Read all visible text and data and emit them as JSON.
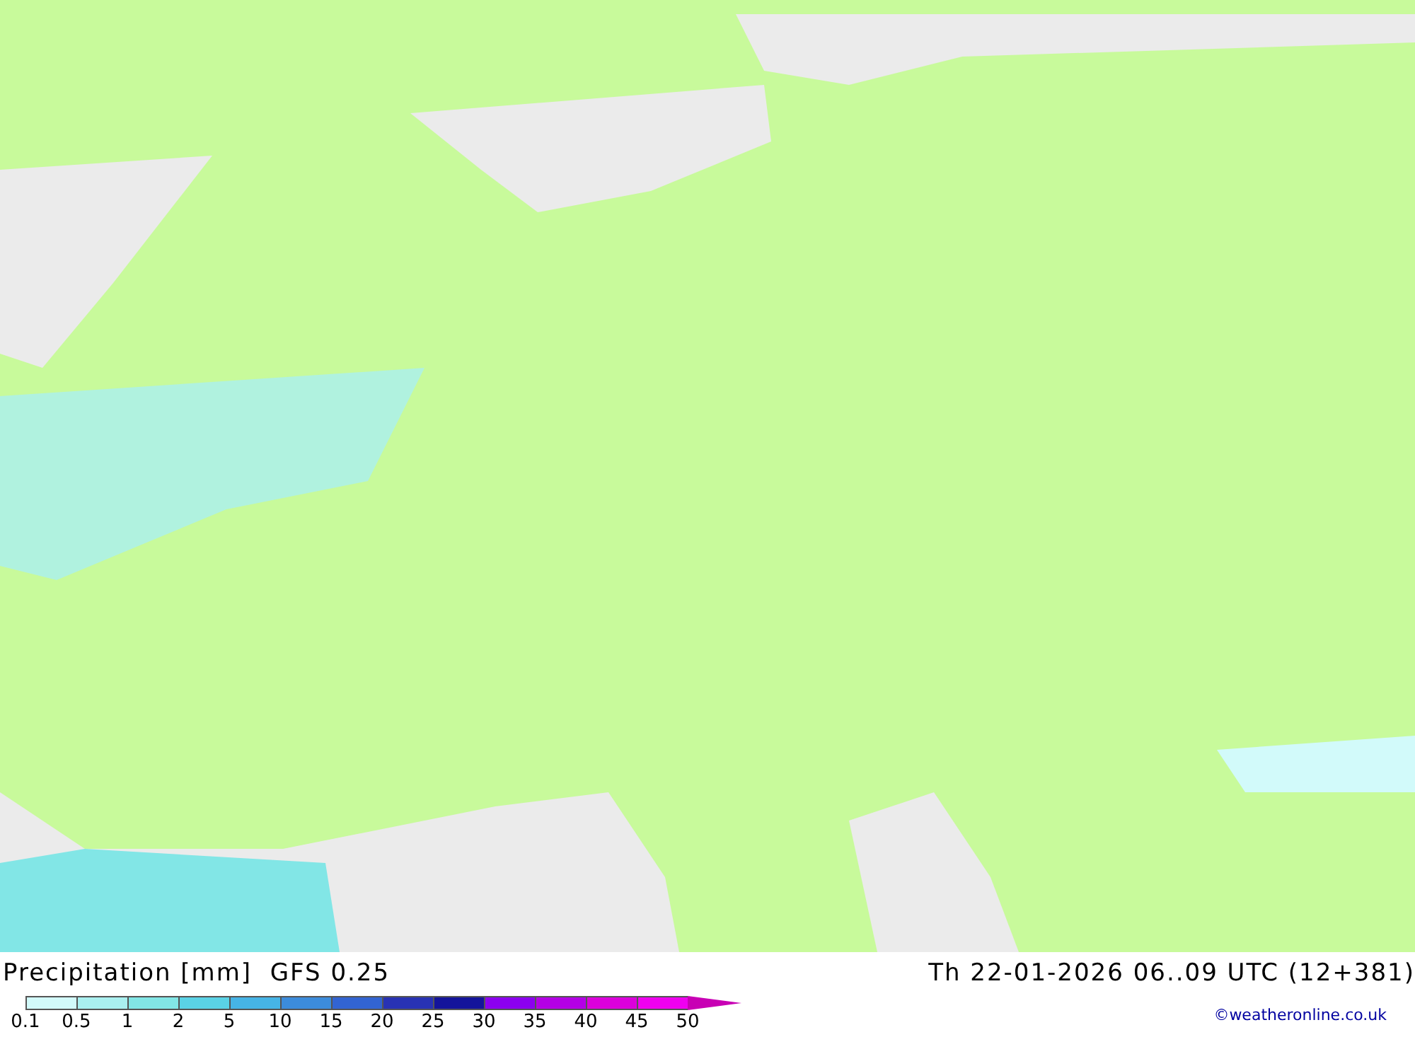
{
  "title": "Precipitation [mm]  GFS 0.25",
  "valid_time": "Th 22-01-2026 06..09 UTC (12+381)",
  "legend": [
    {
      "label": "0.1",
      "color": "#d2fafa"
    },
    {
      "label": "0.5",
      "color": "#aaf0f0"
    },
    {
      "label": "1",
      "color": "#82e6e6"
    },
    {
      "label": "2",
      "color": "#5ad2e6"
    },
    {
      "label": "5",
      "color": "#46b4e6"
    },
    {
      "label": "10",
      "color": "#3c8cdc"
    },
    {
      "label": "15",
      "color": "#3264d2"
    },
    {
      "label": "20",
      "color": "#2832b4"
    },
    {
      "label": "25",
      "color": "#14149b"
    },
    {
      "label": "30",
      "color": "#8c00f0"
    },
    {
      "label": "35",
      "color": "#b400e6"
    },
    {
      "label": "40",
      "color": "#dc00dc"
    },
    {
      "label": "45",
      "color": "#f000f0"
    },
    {
      "label": "50",
      "color": "#c800b4"
    }
  ],
  "credit": "©weatheronline.co.uk"
}
